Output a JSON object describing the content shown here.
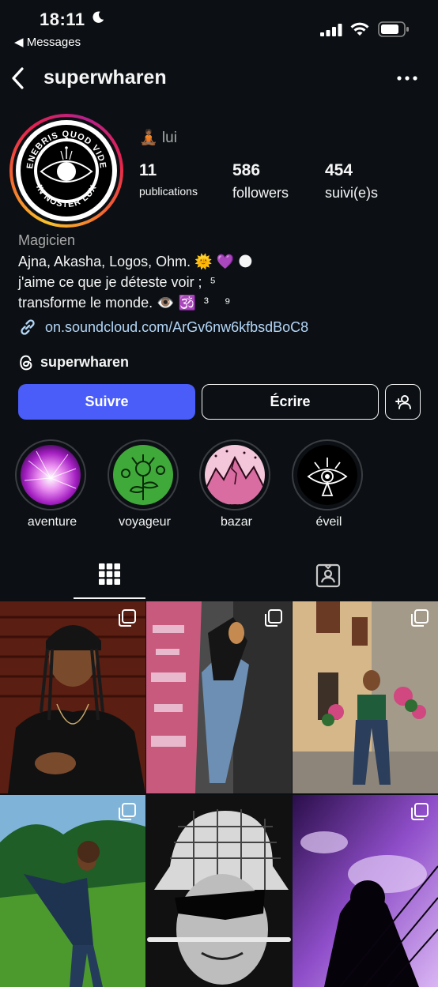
{
  "status_bar": {
    "time": "18:11",
    "back_app": "◀ Messages"
  },
  "header": {
    "username": "superwharen"
  },
  "profile": {
    "pronoun": "🧘🏾 lui",
    "stats": [
      {
        "value": "11",
        "label": "publications"
      },
      {
        "value": "586",
        "label": "followers"
      },
      {
        "value": "454",
        "label": "suivi(e)s"
      }
    ],
    "category": "Magicien",
    "bio": "Ajna, Akasha, Logos, Ohm. 🌞 💜 🌑\nj'aime ce que je déteste voir ;  ⁵\ntransforme le monde. 👁️ 🕉️  ³    ⁹",
    "link": "on.soundcloud.com/ArGv6nw6kfbsdBoC8",
    "threads_handle": "superwharen",
    "avatar_text_top": "TENEBRIS QUOD VIDET",
    "avatar_text_bottom": "IN NOSTER LUX"
  },
  "actions": {
    "follow": "Suivre",
    "message": "Écrire"
  },
  "highlights": [
    {
      "label": "aventure"
    },
    {
      "label": "voyageur"
    },
    {
      "label": "bazar"
    },
    {
      "label": "éveil"
    }
  ],
  "colors": {
    "background": "#0c1014",
    "accent_button": "#4a5df9",
    "link": "#b3d6f7",
    "muted_text": "#a8a8a8"
  },
  "icons": [
    "moon-icon",
    "signal-icon",
    "wifi-icon",
    "battery-icon",
    "back-chevron-icon",
    "more-icon",
    "link-icon",
    "threads-icon",
    "add-person-icon",
    "grid-icon",
    "tagged-icon",
    "multiple-posts-icon"
  ]
}
